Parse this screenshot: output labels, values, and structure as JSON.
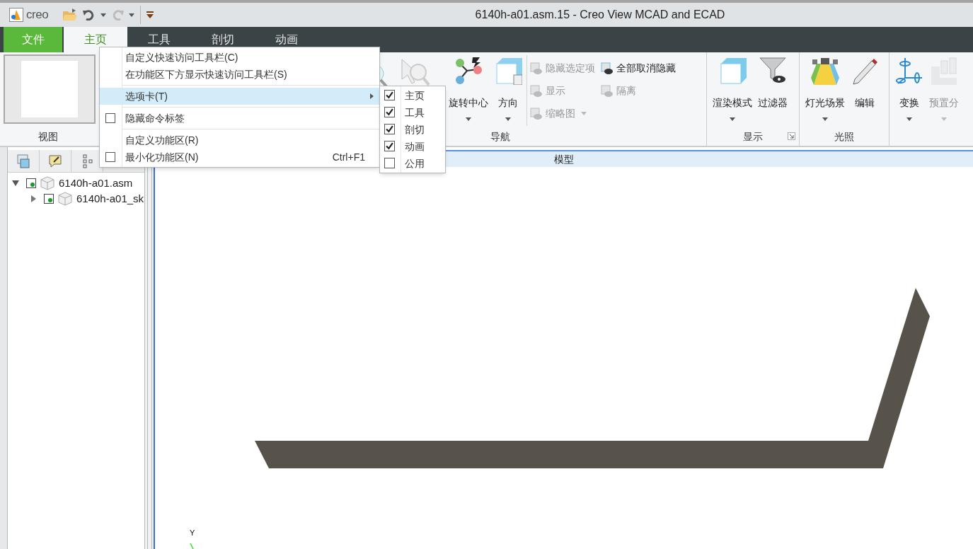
{
  "title_bar": {
    "logo_text": "creo",
    "title": "6140h-a01.asm.15 - Creo View MCAD and ECAD"
  },
  "ribbon_tabs": [
    {
      "label": "文件",
      "kind": "file",
      "selected": false
    },
    {
      "label": "主页",
      "kind": "tab",
      "selected": true
    },
    {
      "label": "工具",
      "kind": "tab",
      "selected": false
    },
    {
      "label": "剖切",
      "kind": "tab",
      "selected": false
    },
    {
      "label": "动画",
      "kind": "tab",
      "selected": false
    }
  ],
  "ribbon_groups": [
    {
      "label": "视图",
      "kind": "thumbnail"
    },
    {
      "label": "导航",
      "kind": "navigation",
      "large_buttons": [
        {
          "label": "旋转中心",
          "dropdown": true,
          "disabled": false
        },
        {
          "label": "方向",
          "dropdown": true,
          "disabled": false
        }
      ],
      "small_buttons": [
        {
          "label": "隐藏选定项",
          "disabled": true,
          "dropdown": false
        },
        {
          "label": "显示",
          "disabled": true,
          "dropdown": false
        },
        {
          "label": "缩略图",
          "disabled": true,
          "dropdown": true
        },
        {
          "label": "全部取消隐藏",
          "disabled": false,
          "dropdown": false
        },
        {
          "label": "隔离",
          "disabled": true,
          "dropdown": false
        }
      ]
    },
    {
      "label": "显示",
      "kind": "buttons",
      "launcher": true,
      "large_buttons": [
        {
          "label": "渲染模式",
          "dropdown": true,
          "disabled": false
        },
        {
          "label": "过滤器",
          "dropdown": false,
          "disabled": false
        }
      ]
    },
    {
      "label": "光照",
      "kind": "buttons",
      "launcher": false,
      "large_buttons": [
        {
          "label": "灯光场景",
          "dropdown": true,
          "disabled": false
        },
        {
          "label": "编辑",
          "dropdown": false,
          "disabled": false
        }
      ]
    },
    {
      "kind": "buttons",
      "launcher": false,
      "large_buttons": [
        {
          "label": "变换",
          "dropdown": true,
          "disabled": false
        },
        {
          "label": "预置分",
          "dropdown": true,
          "disabled": true
        }
      ]
    }
  ],
  "model_tree": {
    "nodes": [
      {
        "label": "6140h-a01.asm",
        "expanded": true,
        "children": [
          {
            "label": "6140h-a01_sk",
            "expanded": false
          }
        ]
      }
    ]
  },
  "viewport": {
    "header": "模型",
    "axis_label": "Y"
  },
  "context_menu": {
    "items": [
      {
        "kind": "item",
        "label": "自定义快速访问工具栏(C)"
      },
      {
        "kind": "item",
        "label": "在功能区下方显示快速访问工具栏(S)"
      },
      {
        "kind": "separator"
      },
      {
        "kind": "submenu",
        "label": "选项卡(T)",
        "selected": true
      },
      {
        "kind": "separator"
      },
      {
        "kind": "check",
        "label": "隐藏命令标签",
        "checked": false
      },
      {
        "kind": "separator"
      },
      {
        "kind": "item",
        "label": "自定义功能区(R)"
      },
      {
        "kind": "check",
        "label": "最小化功能区(N)",
        "checked": false,
        "shortcut": "Ctrl+F1"
      }
    ],
    "submenu": [
      {
        "label": "主页",
        "checked": true
      },
      {
        "label": "工具",
        "checked": true
      },
      {
        "label": "剖切",
        "checked": true
      },
      {
        "label": "动画",
        "checked": true
      },
      {
        "label": "公用",
        "checked": false
      }
    ]
  }
}
